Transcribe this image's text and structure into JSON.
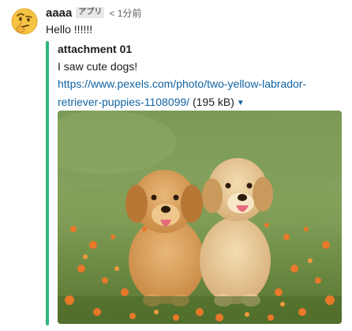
{
  "message": {
    "sender": "aaaa",
    "app_badge": "アプリ",
    "timestamp": "< 1分前",
    "text": "Hello !!!!!!",
    "avatar_icon": "thinking-face-emoji-icon"
  },
  "attachment": {
    "bar_color": "#2eb67d",
    "title": "attachment 01",
    "description": "I saw cute dogs!",
    "link_text": "https://www.pexels.com/photo/two-yellow-labrador-retriever-puppies-1108099/",
    "file_size": "(195 kB)",
    "expand_icon": "caret-down-icon",
    "image_subject": "two-yellow-labrador-puppies-photo"
  }
}
